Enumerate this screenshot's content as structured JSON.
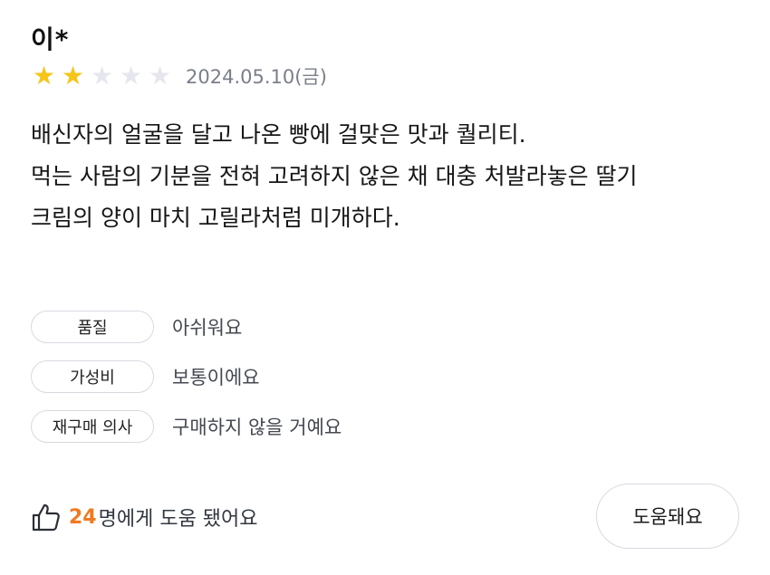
{
  "review": {
    "reviewer": "이*",
    "rating": 2,
    "rating_max": 5,
    "date": "2024.05.10(금)",
    "body_lines": [
      "배신자의 얼굴을 달고 나온 빵에 걸맞은 맛과 퀄리티.",
      "먹는 사람의 기분을 전혀 고려하지 않은 채 대충 처발라놓은 딸기",
      "크림의 양이 마치 고릴라처럼 미개하다."
    ],
    "attributes": [
      {
        "label": "품질",
        "value": "아쉬워요"
      },
      {
        "label": "가성비",
        "value": "보통이에요"
      },
      {
        "label": "재구매 의사",
        "value": "구매하지 않을 거예요"
      }
    ],
    "helpful": {
      "count": "24",
      "count_suffix": "명에게 도움 됐어요",
      "button_label": "도움돼요",
      "icon": "thumbs-up-icon"
    },
    "colors": {
      "star_filled": "#f5c518",
      "star_empty": "#e6e7ee",
      "accent": "#f07a21",
      "chip_border": "#d7dae0"
    }
  }
}
